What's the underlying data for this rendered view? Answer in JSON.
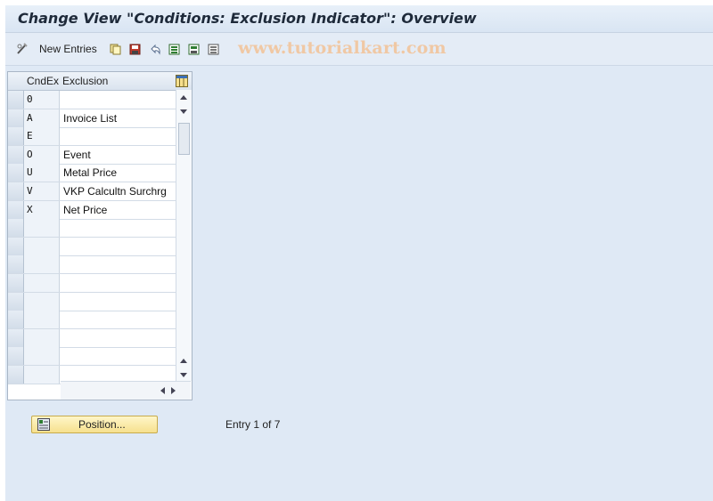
{
  "window": {
    "title": "Change View \"Conditions: Exclusion Indicator\": Overview"
  },
  "toolbar": {
    "new_entries_label": "New Entries",
    "watermark": "www.tutorialkart.com",
    "icons": [
      "pencil-glasses-icon",
      "copy-icon",
      "save-icon",
      "undo-icon",
      "select-all-icon",
      "select-block-icon",
      "deselect-all-icon"
    ]
  },
  "table": {
    "columns": [
      "CndEx",
      "Exclusion"
    ],
    "rows": [
      {
        "key": "0",
        "text": ""
      },
      {
        "key": "A",
        "text": "Invoice List"
      },
      {
        "key": "E",
        "text": ""
      },
      {
        "key": "O",
        "text": "Event"
      },
      {
        "key": "U",
        "text": "Metal Price"
      },
      {
        "key": "V",
        "text": "VKP Calcultn Surchrg"
      },
      {
        "key": "X",
        "text": "Net Price"
      },
      {
        "key": "",
        "text": ""
      },
      {
        "key": "",
        "text": ""
      },
      {
        "key": "",
        "text": ""
      },
      {
        "key": "",
        "text": ""
      },
      {
        "key": "",
        "text": ""
      },
      {
        "key": "",
        "text": ""
      },
      {
        "key": "",
        "text": ""
      },
      {
        "key": "",
        "text": ""
      },
      {
        "key": "",
        "text": ""
      }
    ]
  },
  "footer": {
    "position_button": "Position...",
    "entry_status": "Entry 1 of 7"
  }
}
